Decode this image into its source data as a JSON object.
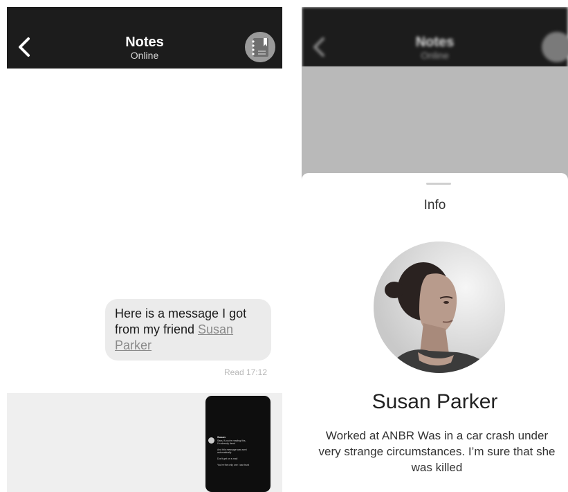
{
  "left_screen": {
    "header": {
      "title": "Notes",
      "subtitle": "Online",
      "back_icon": "chevron-left-icon",
      "avatar_icon": "notebook-icon"
    },
    "message": {
      "text_before": "Here is a message I got from my friend ",
      "link_text": "Susan Parker",
      "status": "Read 17:12"
    },
    "attachment": {
      "sender": "Susan",
      "lines": [
        "Sara, if you're reading this,",
        "I'm already dead",
        "And this message was sent",
        "automatically",
        "Don't get on e-mail",
        "You're the only one I can trust"
      ]
    }
  },
  "right_screen": {
    "header": {
      "title": "Notes",
      "subtitle": "Online"
    },
    "sheet": {
      "title": "Info",
      "name": "Susan Parker",
      "bio": "Worked at ANBR Was in a car crash under very strange circumstances. I’m sure that she was killed"
    }
  },
  "colors": {
    "header_bg": "#1c1c1c",
    "bubble_bg": "#ebebeb",
    "link": "#8a8a8a",
    "overlay": "#b9b9b9"
  }
}
